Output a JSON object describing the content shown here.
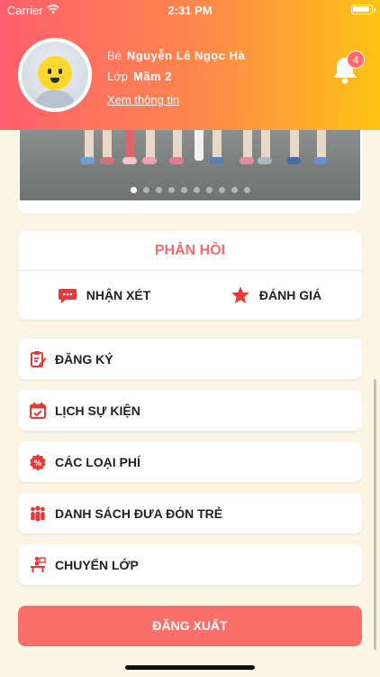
{
  "status_bar": {
    "carrier": "Carrier",
    "time": "2:31 PM"
  },
  "profile": {
    "child_label": "Bé",
    "child_name": "Nguyễn Lê Ngọc Hà",
    "class_label": "Lớp",
    "class_name": "Mầm 2",
    "view_info": "Xem thông tin"
  },
  "notifications": {
    "count": "4"
  },
  "carousel": {
    "slide_count": 10,
    "active_index": 0
  },
  "feedback": {
    "title": "PHẢN HỒI",
    "comment_label": "NHẬN XÉT",
    "rating_label": "ĐÁNH GIÁ"
  },
  "menu": {
    "items": [
      {
        "label": "ĐĂNG KÝ",
        "icon": "clipboard-edit-icon"
      },
      {
        "label": "LỊCH SỰ KIỆN",
        "icon": "calendar-check-icon"
      },
      {
        "label": "CÁC LOẠI PHÍ",
        "icon": "percent-badge-icon"
      },
      {
        "label": "DANH SÁCH ĐƯA ĐÓN TRẺ",
        "icon": "people-group-icon"
      },
      {
        "label": "CHUYỂN LỚP",
        "icon": "classroom-icon"
      }
    ]
  },
  "logout_label": "ĐĂNG XUẤT",
  "colors": {
    "accent": "#f46a6a",
    "logout": "#fb6f6b",
    "gradient_start": "#ff5f6d",
    "gradient_end": "#ffc312",
    "background": "#fbf6e3"
  }
}
